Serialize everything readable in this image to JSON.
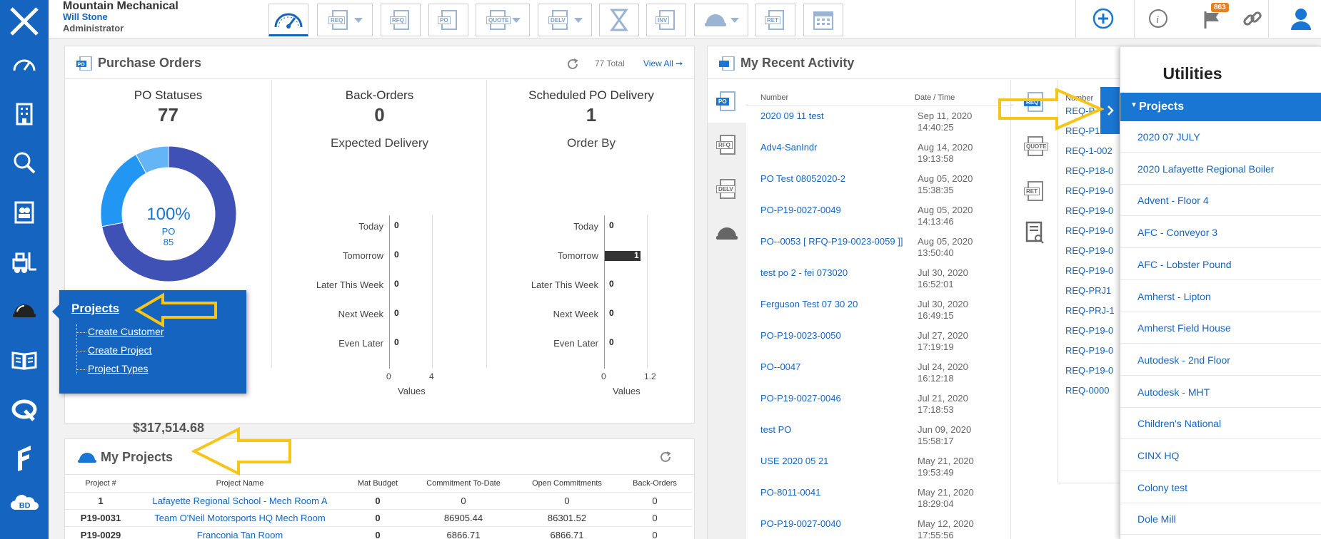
{
  "header": {
    "company": "Mountain Mechanical",
    "user": "Will Stone",
    "role": "Administrator",
    "notification_count": "863",
    "toolbar_buttons": [
      "REQ",
      "RFQ",
      "PO",
      "QUOTE",
      "DELV",
      "INV",
      "RET"
    ]
  },
  "purchase_orders": {
    "title": "Purchase Orders",
    "total": "77 Total",
    "view_all": "View All ➞",
    "po_statuses": {
      "title": "PO Statuses",
      "count": "77",
      "donut_pct": "100%",
      "donut_label": "PO",
      "donut_count": "85",
      "total_value": "$317,514.68"
    },
    "back_orders": {
      "title": "Back-Orders",
      "count": "0",
      "chart_title": "Expected Delivery"
    },
    "scheduled": {
      "title": "Scheduled PO Delivery",
      "count": "1",
      "chart_title": "Order By"
    }
  },
  "chart_data": [
    {
      "type": "bar",
      "title": "Expected Delivery",
      "categories": [
        "Today",
        "Tomorrow",
        "Later This Week",
        "Next Week",
        "Even Later"
      ],
      "values": [
        0,
        0,
        0,
        0,
        0
      ],
      "xlabel": "Values",
      "xticks": [
        "0",
        "4"
      ],
      "xlim": [
        0,
        4
      ]
    },
    {
      "type": "bar",
      "title": "Order By",
      "categories": [
        "Today",
        "Tomorrow",
        "Later This Week",
        "Next Week",
        "Even Later"
      ],
      "values": [
        0,
        1,
        0,
        0,
        0
      ],
      "xlabel": "Values",
      "xticks": [
        "0",
        "1.2"
      ],
      "xlim": [
        0,
        1.2
      ]
    },
    {
      "type": "pie",
      "title": "PO Statuses",
      "categories": [
        "",
        "",
        ""
      ],
      "values": [
        72,
        20,
        8
      ],
      "colors": [
        "#3f51b5",
        "#2196f3",
        "#64b5f6"
      ]
    }
  ],
  "popup": {
    "title": "Projects",
    "items": [
      "Create Customer",
      "Create Project",
      "Project Types"
    ]
  },
  "my_projects": {
    "title": "My Projects",
    "columns": [
      "Project #",
      "Project Name",
      "Mat Budget",
      "Commitment To-Date",
      "Open Commitments",
      "Back-Orders"
    ],
    "rows": [
      [
        "1",
        "Lafayette Regional School - Mech Room A",
        "0",
        "0",
        "0",
        "0"
      ],
      [
        "P19-0031",
        "Team O'Neil Motorsports HQ Mech Room",
        "0",
        "86905.44",
        "86301.52",
        "0"
      ],
      [
        "P19-0029",
        "Franconia Tan Room",
        "0",
        "6866.71",
        "6866.71",
        "0"
      ]
    ]
  },
  "activity": {
    "title": "My Recent Activity",
    "col_number": "Number",
    "col_date": "Date / Time",
    "tabs": [
      "PO",
      "RFQ",
      "DELV"
    ],
    "right_tabs": [
      "REQ",
      "QUOTE",
      "RET"
    ],
    "rows": [
      {
        "number": "2020 09 11 test",
        "date": "Sep 11, 2020",
        "time": "14:40:25"
      },
      {
        "number": "Adv4-SanIndr",
        "date": "Aug 14, 2020",
        "time": "19:13:58"
      },
      {
        "number": "PO Test 08052020-2",
        "date": "Aug 05, 2020",
        "time": "15:38:35"
      },
      {
        "number": "PO-P19-0027-0049",
        "date": "Aug 05, 2020",
        "time": "14:13:46"
      },
      {
        "number": "PO--0053 [ RFQ-P19-0023-0059 ]]",
        "date": "Aug 05, 2020",
        "time": "13:50:40"
      },
      {
        "number": "test po 2 - fei 073020",
        "date": "Jul 30, 2020",
        "time": "16:52:01"
      },
      {
        "number": "Ferguson Test 07 30 20",
        "date": "Jul 30, 2020",
        "time": "16:49:15"
      },
      {
        "number": "PO-P19-0023-0050",
        "date": "Jul 27, 2020",
        "time": "17:19:19"
      },
      {
        "number": "PO--0047",
        "date": "Jul 24, 2020",
        "time": "16:12:18"
      },
      {
        "number": "PO-P19-0027-0046",
        "date": "Jul 21, 2020",
        "time": "17:18:53"
      },
      {
        "number": "test PO",
        "date": "Jun 09, 2020",
        "time": "15:58:17"
      },
      {
        "number": "USE 2020 05 21",
        "date": "May 21, 2020",
        "time": "19:53:49"
      },
      {
        "number": "PO-8011-0041",
        "date": "May 21, 2020",
        "time": "18:29:04"
      },
      {
        "number": "PO-P19-0027-0040",
        "date": "May 12, 2020",
        "time": "17:55:56"
      }
    ],
    "req_col": "Number",
    "req_rows": [
      "REQ-P",
      "REQ-P19-",
      "REQ-1-002",
      "REQ-P18-0",
      "REQ-P19-0",
      "REQ-P19-0",
      "REQ-P19-0",
      "REQ-P19-0",
      "REQ-P19-0",
      "REQ-PRJ1",
      "REQ-PRJ-1",
      "REQ-P19-0",
      "REQ-P19-0",
      "REQ-P19-0",
      "REQ-0000"
    ]
  },
  "utilities": {
    "title": "Utilities",
    "section": "Projects",
    "items": [
      "2020 07 JULY",
      "2020 Lafayette Regional Boiler",
      "Advent - Floor 4",
      "AFC - Conveyor 3",
      "AFC - Lobster Pound",
      "Amherst - Lipton",
      "Amherst Field House",
      "Autodesk - 2nd Floor",
      "Autodesk - MHT",
      "Children's National",
      "CINX HQ",
      "Colony test",
      "Dole Mill"
    ]
  }
}
